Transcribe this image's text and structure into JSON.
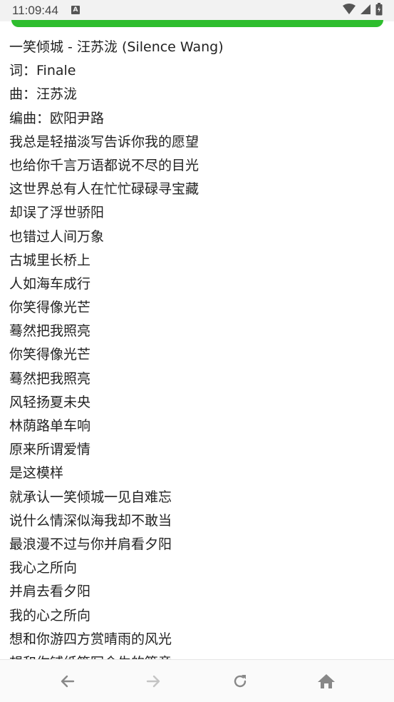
{
  "status_bar": {
    "time": "11:09:44",
    "notification_badge": "A"
  },
  "lyrics": {
    "lines": [
      "一笑倾城 - 汪苏泷 (Silence Wang)",
      "词：Finale",
      "曲：汪苏泷",
      "编曲：欧阳尹路",
      "我总是轻描淡写告诉你我的愿望",
      "也给你千言万语都说不尽的目光",
      "这世界总有人在忙忙碌碌寻宝藏",
      "却误了浮世骄阳",
      "也错过人间万象",
      "古城里长桥上",
      "人如海车成行",
      "你笑得像光芒",
      "蓦然把我照亮",
      "你笑得像光芒",
      "蓦然把我照亮",
      "风轻扬夏未央",
      "林荫路单车响",
      "原来所谓爱情",
      "是这模样",
      "就承认一笑倾城一见自难忘",
      "说什么情深似海我却不敢当",
      "最浪漫不过与你并肩看夕阳",
      "我心之所向",
      "并肩去看夕阳",
      "我的心之所向",
      "想和你游四方赏晴雨的风光",
      "想和你铺纸笺写令生的篇章"
    ]
  },
  "colors": {
    "accent_green": "#2ebd2e",
    "nav_icon": "#888888"
  }
}
